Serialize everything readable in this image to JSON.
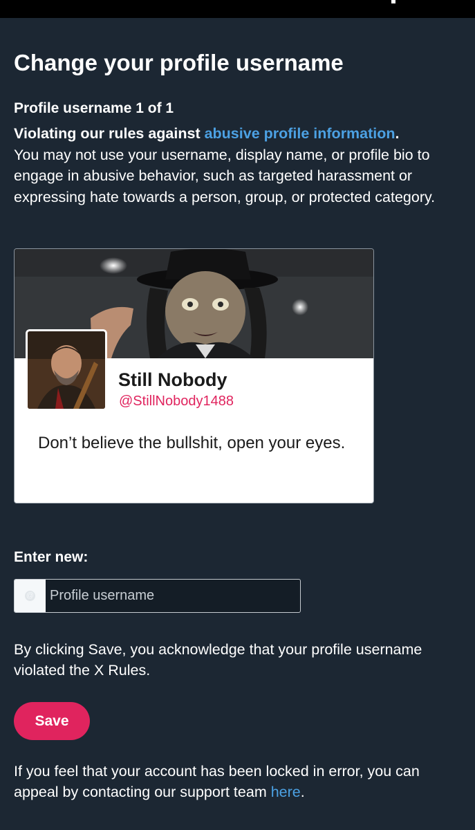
{
  "header": {
    "title": "Change your profile username"
  },
  "notice": {
    "count_label": "Profile username 1 of 1",
    "violation_lead": "Violating our rules against ",
    "violation_link": "abusive profile information",
    "violation_end": ".",
    "description": "You may not use your username, display name, or profile bio to engage in abusive behavior, such as targeted harassment or expressing hate towards a person, group, or protected category."
  },
  "profile": {
    "display_name": "Still Nobody",
    "handle": "@StillNobody1488",
    "bio": "Don’t believe the bullshit, open your eyes."
  },
  "form": {
    "label": "Enter new:",
    "at_symbol": "@",
    "placeholder": "Profile username",
    "value": "",
    "acknowledgement": "By clicking Save, you acknowledge that your profile username violated the X Rules.",
    "save_label": "Save"
  },
  "footer": {
    "appeal_text": "If you feel that your account has been locked in error, you can appeal by contacting our support team ",
    "appeal_link": "here",
    "appeal_end": "."
  },
  "colors": {
    "background": "#1c2733",
    "accent_pink": "#e0245e",
    "link_blue": "#4ca1e3"
  }
}
